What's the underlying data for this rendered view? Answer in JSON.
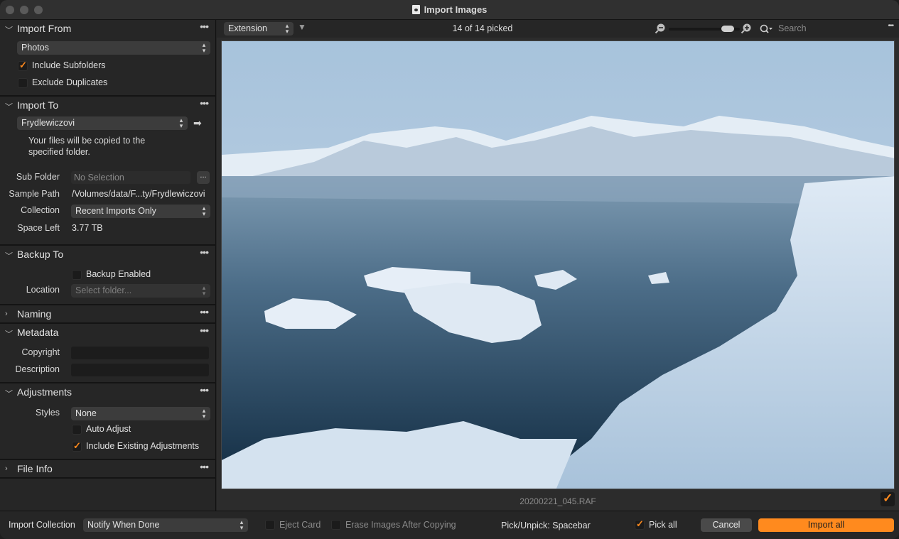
{
  "window": {
    "title": "Import Images"
  },
  "import_from": {
    "title": "Import From",
    "source": "Photos",
    "include_subfolders": {
      "label": "Include Subfolders",
      "checked": true
    },
    "exclude_duplicates": {
      "label": "Exclude Duplicates",
      "checked": false
    }
  },
  "import_to": {
    "title": "Import To",
    "destination": "Frydlewiczovi",
    "note": "Your files will be copied to the specified folder.",
    "sub_folder_label": "Sub Folder",
    "sub_folder_placeholder": "No Selection",
    "sub_folder_button": "...",
    "sample_path_label": "Sample Path",
    "sample_path": "/Volumes/data/F...ty/Frydlewiczovi",
    "collection_label": "Collection",
    "collection": "Recent Imports Only",
    "space_left_label": "Space Left",
    "space_left": "3.77 TB"
  },
  "backup_to": {
    "title": "Backup To",
    "backup_enabled": {
      "label": "Backup Enabled",
      "checked": false
    },
    "location_label": "Location",
    "location_placeholder": "Select folder..."
  },
  "naming": {
    "title": "Naming"
  },
  "metadata": {
    "title": "Metadata",
    "copyright_label": "Copyright",
    "copyright": "",
    "description_label": "Description",
    "description": ""
  },
  "adjustments": {
    "title": "Adjustments",
    "styles_label": "Styles",
    "styles": "None",
    "auto_adjust": {
      "label": "Auto Adjust",
      "checked": false
    },
    "include_existing": {
      "label": "Include Existing Adjustments",
      "checked": true
    }
  },
  "file_info": {
    "title": "File Info"
  },
  "toolbar": {
    "sort": "Extension",
    "picked_status": "14 of 14 picked",
    "search_placeholder": "Search",
    "zoom_level": 0.9
  },
  "viewer": {
    "filename": "20200221_045.RAF",
    "picked": true
  },
  "bottom": {
    "import_collection_label": "Import Collection",
    "import_collection": "Notify When Done",
    "eject_card": {
      "label": "Eject Card",
      "checked": false
    },
    "erase_images": {
      "label": "Erase Images After Copying",
      "checked": false
    },
    "shortcut_hint": "Pick/Unpick: Spacebar",
    "pick_all": {
      "label": "Pick all",
      "checked": true
    },
    "cancel": "Cancel",
    "import_all": "Import all"
  },
  "colors": {
    "accent": "#ff8a1e",
    "panel": "#262626",
    "field": "#3c3c3c"
  },
  "icons": [
    "document-icon",
    "chevron-down-icon",
    "chevron-right-icon",
    "more-icon",
    "arrow-right-icon",
    "filter-icon",
    "zoom-out-icon",
    "zoom-in-icon",
    "search-icon"
  ]
}
